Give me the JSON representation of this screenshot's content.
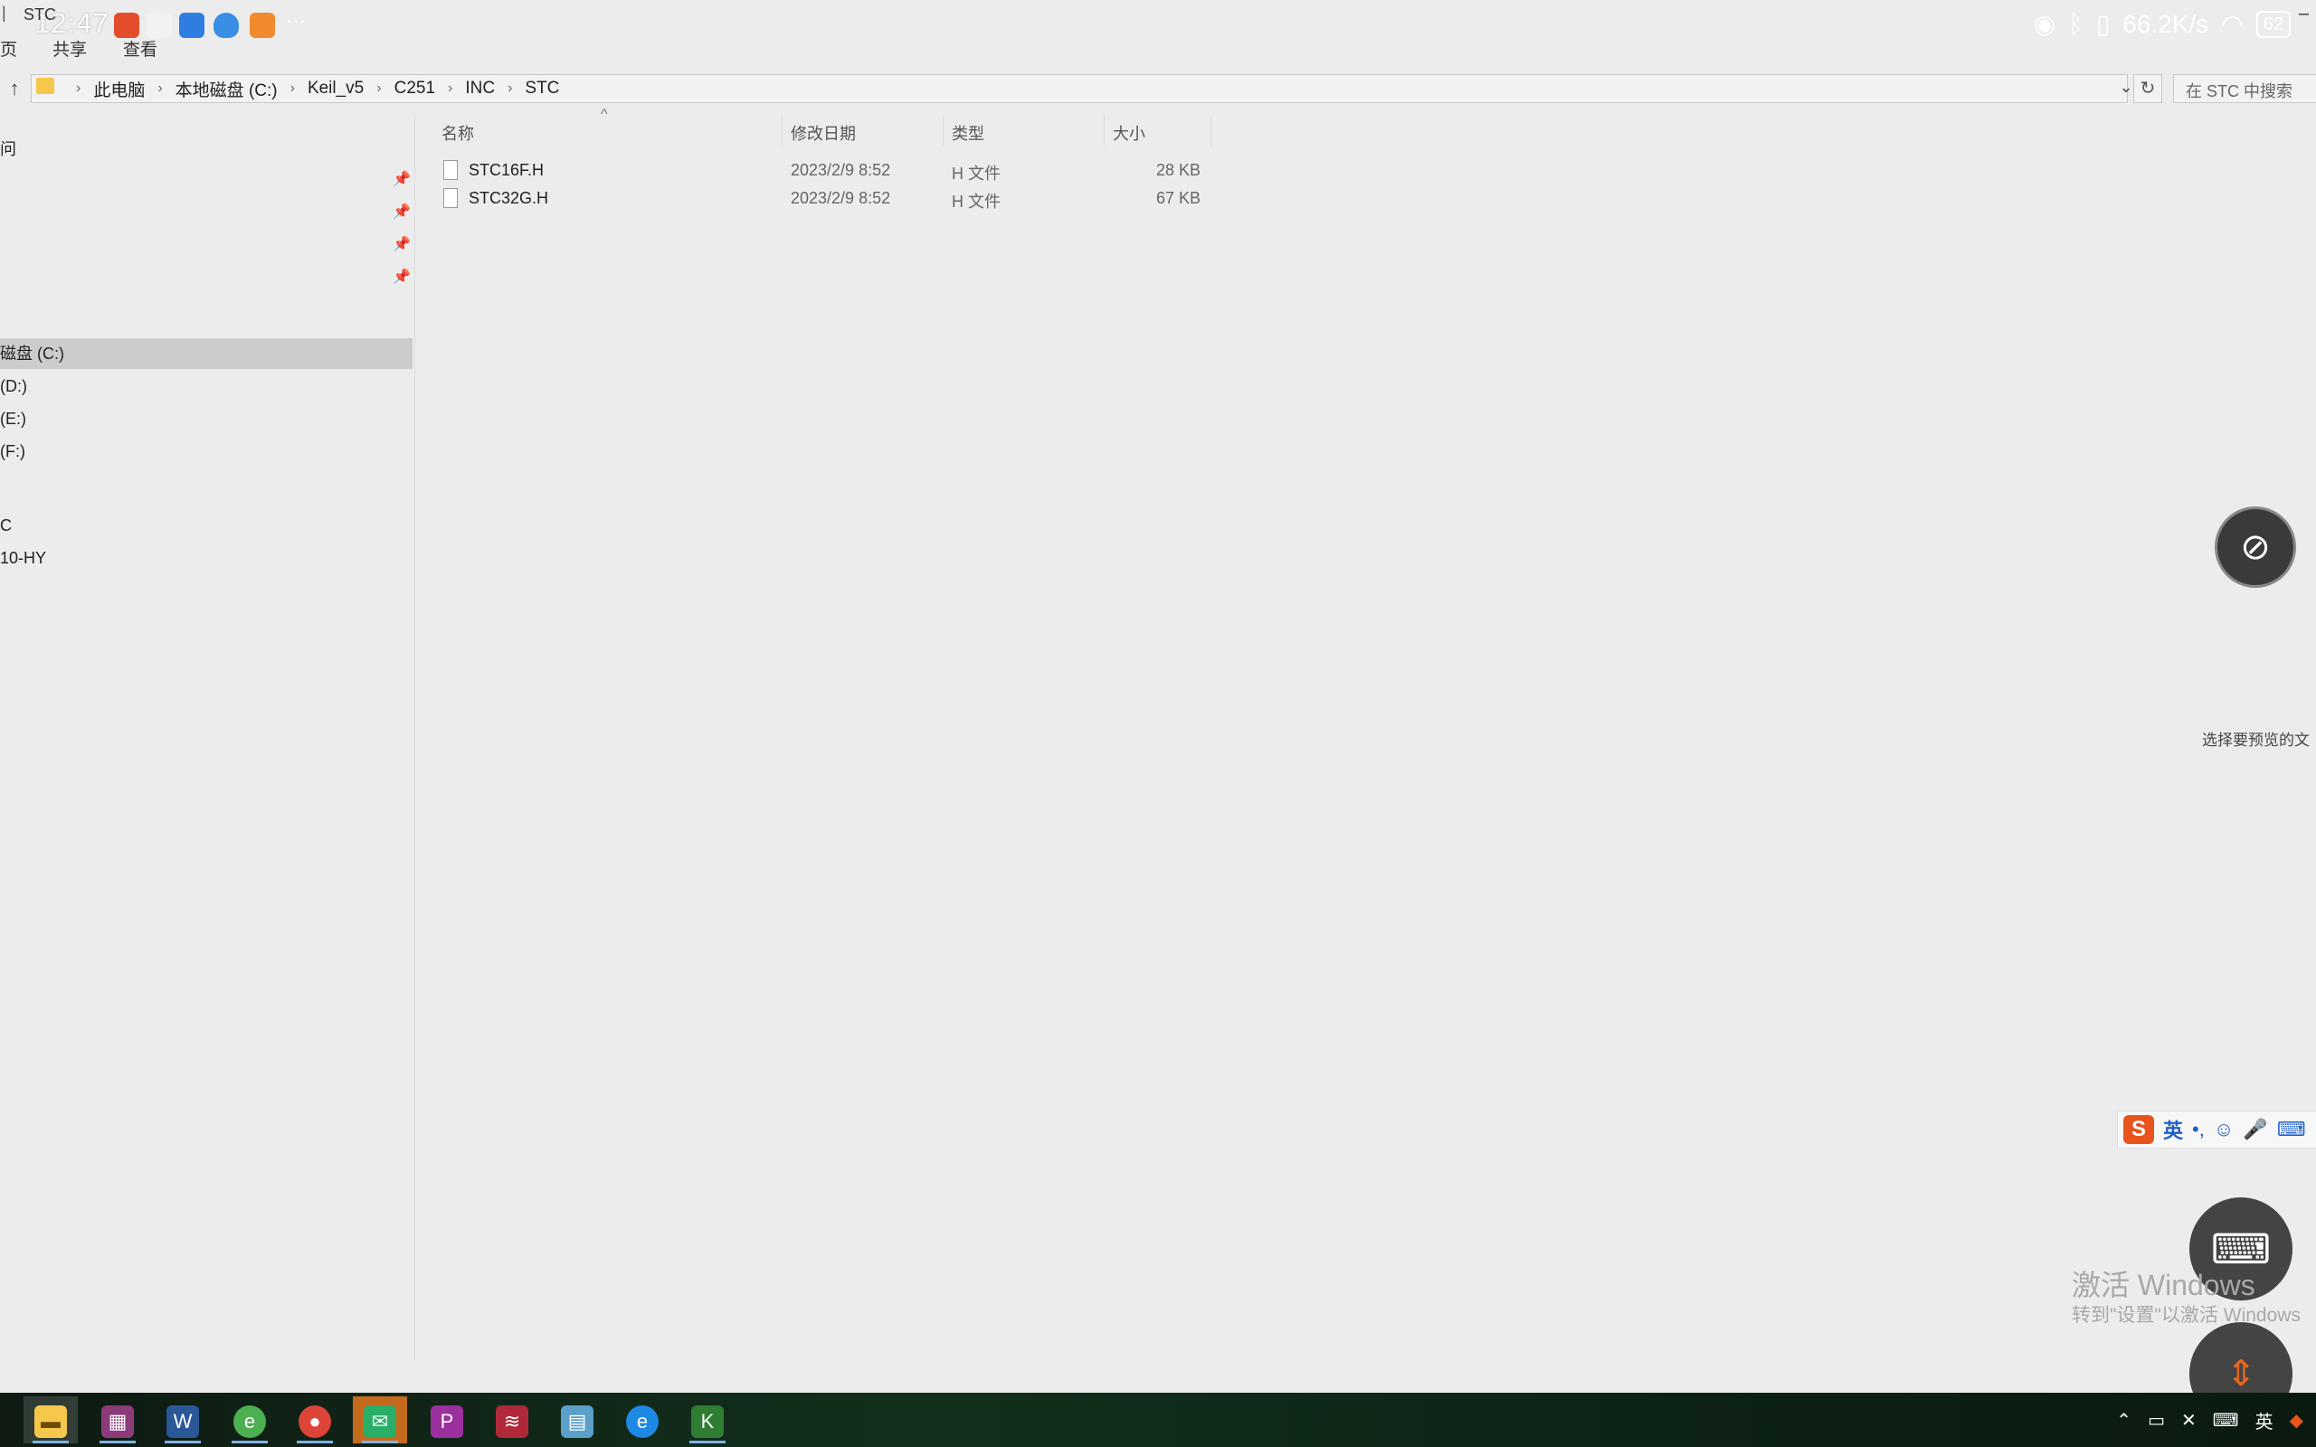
{
  "statusbar": {
    "time": "12:47",
    "net_speed": "66.2K/s",
    "battery": "62",
    "more": "···"
  },
  "window": {
    "title": "STC",
    "ribbon_tabs": [
      "页",
      "共享",
      "查看"
    ]
  },
  "address": {
    "crumbs": [
      "此电脑",
      "本地磁盘 (C:)",
      "Keil_v5",
      "C251",
      "INC",
      "STC"
    ],
    "search_placeholder": "在 STC 中搜索"
  },
  "nav": {
    "quick_access": "问",
    "drive_c": "磁盘 (C:)",
    "drive_d": "(D:)",
    "drive_e": "(E:)",
    "drive_f": "(F:)",
    "net1": "C",
    "net2": "10-HY"
  },
  "columns": {
    "name": "名称",
    "date": "修改日期",
    "type": "类型",
    "size": "大小"
  },
  "files": [
    {
      "name": "STC16F.H",
      "date": "2023/2/9 8:52",
      "type": "H 文件",
      "size": "28 KB"
    },
    {
      "name": "STC32G.H",
      "date": "2023/2/9 8:52",
      "type": "H 文件",
      "size": "67 KB"
    }
  ],
  "preview_hint": "选择要预览的文",
  "ime": {
    "logo": "S",
    "mode": "英"
  },
  "watermark": {
    "line1": "激活 Windows",
    "line2": "转到\"设置\"以激活 Windows"
  },
  "tray": {
    "ime": "英"
  }
}
